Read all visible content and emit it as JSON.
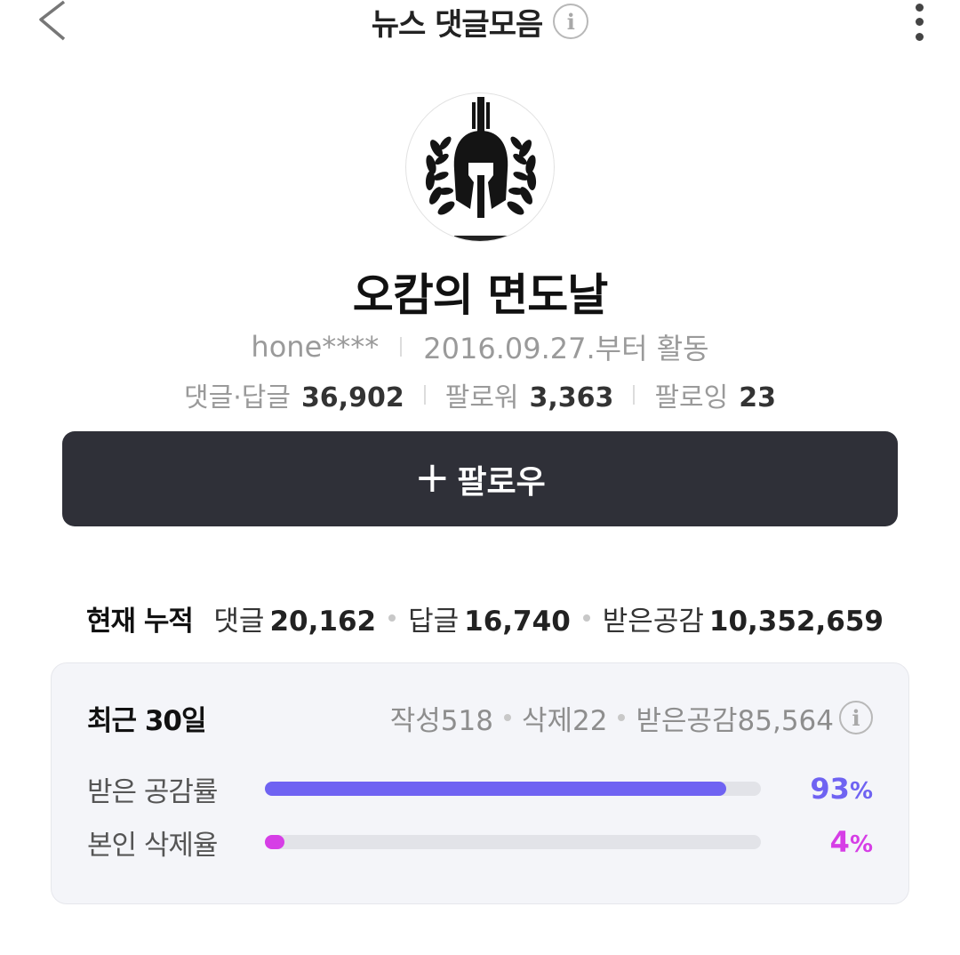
{
  "header": {
    "title": "뉴스 댓글모음",
    "info_icon": "info-icon",
    "back_icon": "chevron-left-icon",
    "more_icon": "more-vertical-icon"
  },
  "profile": {
    "nickname": "오캄의 면도날",
    "user_id": "hone****",
    "active_since": "2016.09.27.부터 활동",
    "stats": [
      {
        "label": "댓글·답글",
        "value": "36,902"
      },
      {
        "label": "팔로워",
        "value": "3,363"
      },
      {
        "label": "팔로잉",
        "value": "23"
      }
    ]
  },
  "follow_button": {
    "plus": "+",
    "label": "팔로우"
  },
  "totals": {
    "label": "현재 누적",
    "items": [
      {
        "label": "댓글",
        "value": "20,162"
      },
      {
        "label": "답글",
        "value": "16,740"
      },
      {
        "label": "받은공감",
        "value": "10,352,659"
      }
    ]
  },
  "recent": {
    "title": "최근 30일",
    "stats": [
      "작성518",
      "삭제22",
      "받은공감85,564"
    ],
    "rates": [
      {
        "label": "받은 공감률",
        "number": "93",
        "unit": "%",
        "fraction": 0.93,
        "color": "#6f63f2"
      },
      {
        "label": "본인 삭제율",
        "number": "4",
        "unit": "%",
        "fraction": 0.04,
        "color": "#d63ee6"
      }
    ]
  },
  "colors": {
    "follow_button_bg": "#2f3038",
    "card_bg": "#f4f5f9",
    "like_rate": "#6f63f2",
    "delete_rate": "#d63ee6"
  }
}
